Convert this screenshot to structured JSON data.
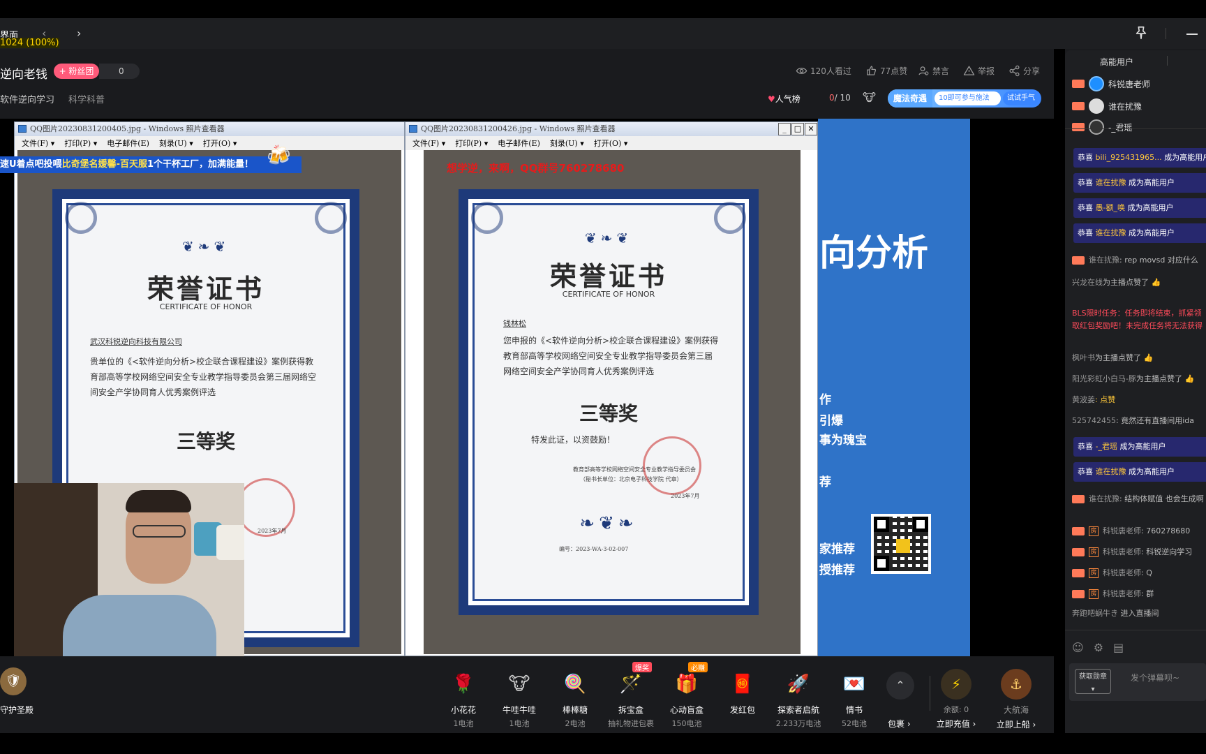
{
  "window": {
    "tab_label": "界面",
    "zoom": "1024 (100%)",
    "back_icon": "chevron-left-icon",
    "forward_icon": "chevron-right-icon"
  },
  "room": {
    "title": "逆向老钱",
    "fan_button": "+ 粉丝团",
    "fan_count": "0",
    "categories": [
      "软件逆向学习",
      "科学科普"
    ],
    "stats": {
      "views": "120人看过",
      "likes": "77点赞",
      "ban": "禁言",
      "report": "举报",
      "share": "分享"
    },
    "popularity_rank": "人气榜",
    "box_count_current": "0",
    "box_count_total": "/ 10",
    "magic": {
      "title": "魔法奇遇",
      "desc": "10即可参与施法",
      "button": "试试手气"
    }
  },
  "video": {
    "window_left": {
      "title": "QQ图片20230831200405.jpg - Windows 照片查看器",
      "menu": [
        "文件(F) ▾",
        "打印(P) ▾",
        "电子邮件(E)",
        "刻录(U) ▾",
        "打开(O) ▾"
      ]
    },
    "window_right": {
      "title": "QQ图片20230831200426.jpg - Windows 照片查看器",
      "menu": [
        "文件(F) ▾",
        "打印(P) ▾",
        "电子邮件(E)",
        "刻录(U) ▾",
        "打开(O) ▾"
      ]
    },
    "cert_left": {
      "title": "荣誉证书",
      "subtitle": "CERTIFICATE OF HONOR",
      "recipient": "武汉科锐逆向科技有限公司",
      "body": "贵单位的《<软件逆向分析>校企联合课程建设》案例获得教育部高等学校网络空间安全专业教学指导委员会第三届网络空间安全产学协同育人优秀案例评选",
      "prize": "三等奖",
      "date": "2023年7月"
    },
    "cert_right": {
      "title": "荣誉证书",
      "subtitle": "CERTIFICATE OF HONOR",
      "recipient": "钱林松",
      "body": "您申报的《<软件逆向分析>校企联合课程建设》案例获得教育部高等学校网络空间安全专业教学指导委员会第三届网络空间安全产学协同育人优秀案例评选",
      "prize": "三等奖",
      "footer": "特发此证，以资鼓励！",
      "issuer": "教育部高等学校网络空间安全专业教学指导委员会",
      "issuer_sub": "（秘书长单位：北京电子科技学院 代章）",
      "date": "2023年7月",
      "serial": "编号：2023-WA-3-02-007"
    },
    "red_overlay": "想学逆，来啊，QQ群号760278680",
    "banner": {
      "prefix": "速U着点吧投喂",
      "highlight": "比奇堡名媛馨-百天服",
      "suffix": "1个干杯工厂，加满能量！"
    },
    "slide": {
      "heading": "向分析",
      "lines": [
        "作",
        "引爆",
        "事为瑰宝",
        "荐",
        "家推荐",
        "授推荐"
      ]
    }
  },
  "gifts": [
    {
      "name": "小花花",
      "price": "1电池",
      "icon": "🌹",
      "tag": ""
    },
    {
      "name": "牛哇牛哇",
      "price": "1电池",
      "icon": "🐮",
      "tag": ""
    },
    {
      "name": "棒棒糖",
      "price": "2电池",
      "icon": "🍭",
      "tag": ""
    },
    {
      "name": "拆宝盒",
      "price": "抽礼物进包裹",
      "icon": "🪄",
      "tag": "爆奖"
    },
    {
      "name": "心动盲盒",
      "price": "150电池",
      "icon": "🎁",
      "tag": "必赚"
    },
    {
      "name": "发红包",
      "price": "",
      "icon": "🧧",
      "tag": ""
    },
    {
      "name": "探索者启航",
      "price": "2.233万电池",
      "icon": "🚀",
      "tag": ""
    },
    {
      "name": "情书",
      "price": "52电池",
      "icon": "💌",
      "tag": ""
    }
  ],
  "giftbar": {
    "guard_label": "守护圣殿",
    "bag_label": "包裹 ›",
    "balance": "余额: 0",
    "recharge": "立即充值 ›",
    "sail_name": "大航海",
    "sail_action": "立即上船 ›"
  },
  "panel": {
    "header": "高能用户",
    "high_energy_users": [
      "科锐唐老师",
      "谁在扰豫",
      "-_君瑶"
    ],
    "chat": [
      {
        "type": "congrats",
        "user": "bili_925431965...",
        "text": "成为高能用户"
      },
      {
        "type": "congrats",
        "user": "谁在扰豫",
        "text": "成为高能用户"
      },
      {
        "type": "congrats",
        "user": "愚-额_唤",
        "text": "成为高能用户"
      },
      {
        "type": "congrats",
        "user": "谁在扰豫",
        "text": "成为高能用户"
      },
      {
        "type": "msg",
        "user": "谁在扰豫",
        "text": ": rep movsd 对应什么"
      },
      {
        "type": "like",
        "user": "兴龙在线",
        "text": "为主播点赞了"
      },
      {
        "type": "task",
        "text": "BLS限时任务：任务即将结束，抓紧领取红包奖励吧！未完成任务将无法获得"
      },
      {
        "type": "like",
        "user": "枫叶书",
        "text": "为主播点赞了"
      },
      {
        "type": "like",
        "user": "阳光彩虹小白马-豚",
        "text": "为主播点赞了"
      },
      {
        "type": "msg",
        "user": "黄波姜",
        "text": ": 点赞"
      },
      {
        "type": "msg",
        "user": "525742455",
        "text": ": 竟然还有直播间用ida"
      },
      {
        "type": "congrats",
        "user": "-_君瑶",
        "text": "成为高能用户"
      },
      {
        "type": "congrats",
        "user": "谁在扰豫",
        "text": "成为高能用户"
      },
      {
        "type": "msg",
        "user": "谁在扰豫",
        "text": ": 结构体赋值 也会生成啊"
      },
      {
        "type": "owner",
        "user": "科锐唐老师",
        "text": ": 760278680"
      },
      {
        "type": "owner",
        "user": "科锐唐老师",
        "text": ": 科锐逆向学习"
      },
      {
        "type": "owner",
        "user": "科锐唐老师",
        "text": ": Q"
      },
      {
        "type": "owner",
        "user": "科锐唐老师",
        "text": ": 群"
      },
      {
        "type": "enter",
        "user": "奔跑吧蜗牛き",
        "text": "进入直播间"
      }
    ],
    "fetch_medal": "获取勋章",
    "danmu_placeholder": "发个弹幕呗~"
  }
}
